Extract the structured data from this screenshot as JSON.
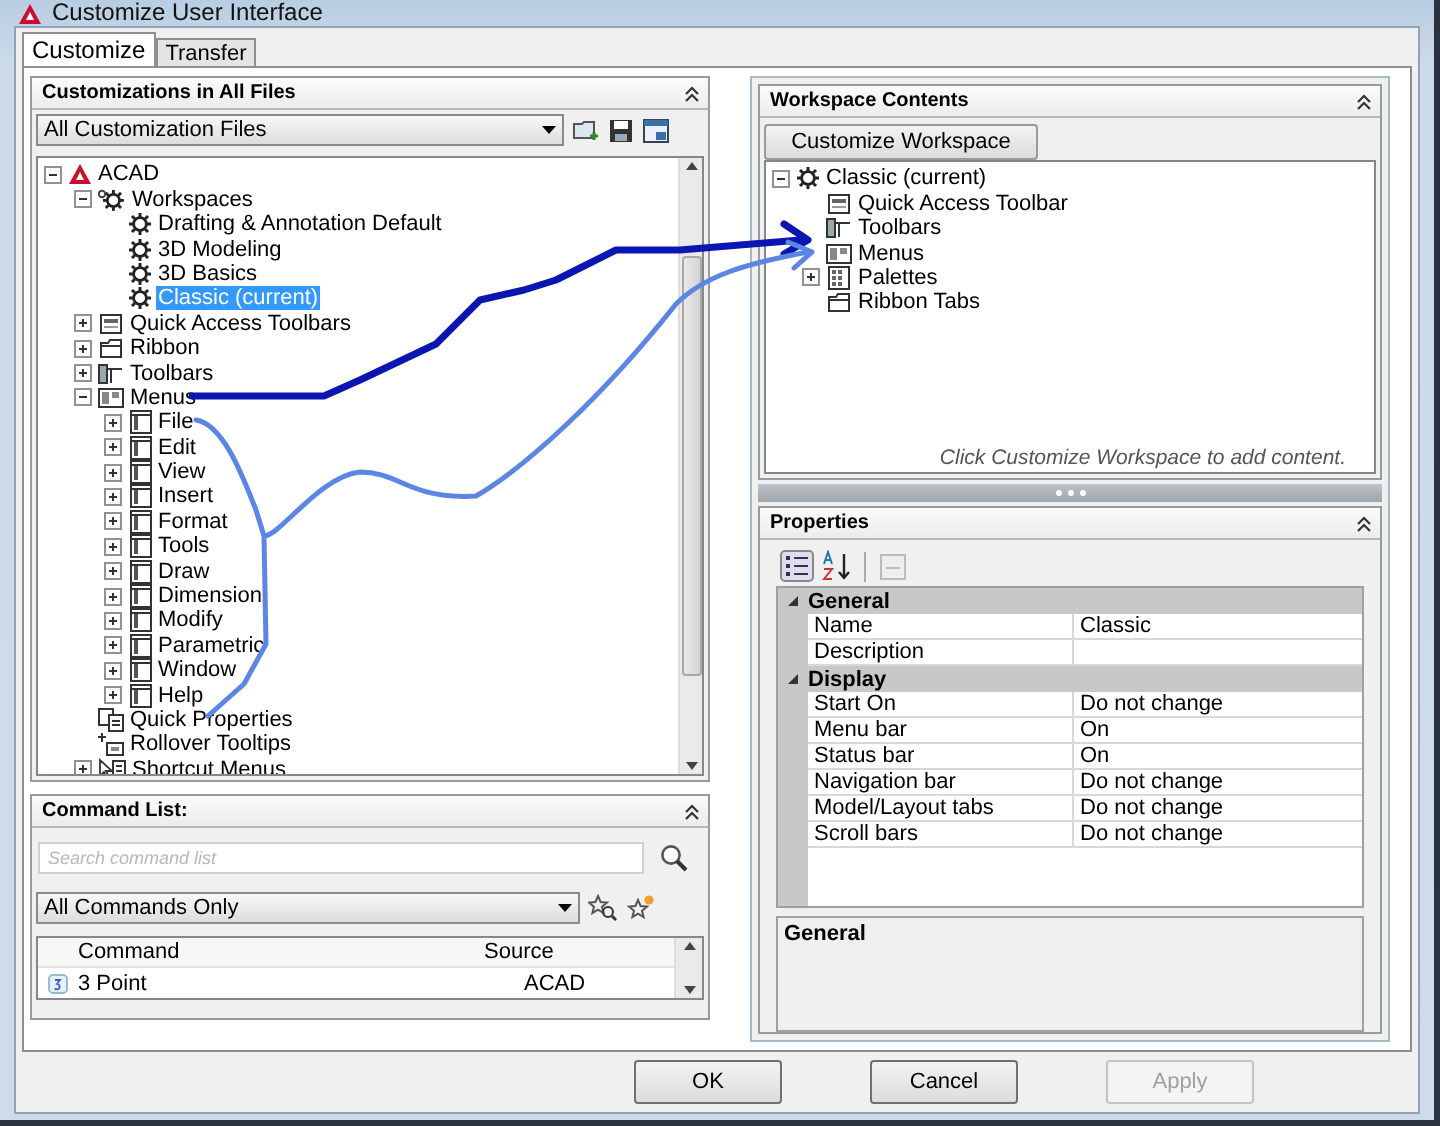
{
  "window": {
    "title": "Customize User Interface"
  },
  "tabs": [
    {
      "label": "Customize",
      "selected": true
    },
    {
      "label": "Transfer",
      "selected": false
    }
  ],
  "customizations_panel": {
    "title": "Customizations in All Files",
    "filter": "All Customization Files",
    "tree": [
      {
        "label": "ACAD",
        "kind": "logo",
        "expanded": true,
        "selected": false,
        "children": [
          {
            "label": "Workspaces",
            "kind": "gears",
            "expanded": true,
            "selected": false,
            "children": [
              {
                "label": "Drafting & Annotation Default",
                "kind": "gear",
                "selected": false
              },
              {
                "label": "3D Modeling",
                "kind": "gear",
                "selected": false
              },
              {
                "label": "3D Basics",
                "kind": "gear",
                "selected": false
              },
              {
                "label": "Classic (current)",
                "kind": "gear",
                "selected": true
              }
            ]
          },
          {
            "label": "Quick Access Toolbars",
            "kind": "qat",
            "expanded": false,
            "selected": false
          },
          {
            "label": "Ribbon",
            "kind": "ribbon",
            "expanded": false,
            "selected": false
          },
          {
            "label": "Toolbars",
            "kind": "toolbar",
            "expanded": false,
            "selected": false
          },
          {
            "label": "Menus",
            "kind": "menus",
            "expanded": true,
            "selected": false,
            "children": [
              {
                "label": "File",
                "kind": "menu",
                "expanded": false,
                "selected": false
              },
              {
                "label": "Edit",
                "kind": "menu",
                "expanded": false,
                "selected": false
              },
              {
                "label": "View",
                "kind": "menu",
                "expanded": false,
                "selected": false
              },
              {
                "label": "Insert",
                "kind": "menu",
                "expanded": false,
                "selected": false
              },
              {
                "label": "Format",
                "kind": "menu",
                "expanded": false,
                "selected": false
              },
              {
                "label": "Tools",
                "kind": "menu",
                "expanded": false,
                "selected": false
              },
              {
                "label": "Draw",
                "kind": "menu",
                "expanded": false,
                "selected": false
              },
              {
                "label": "Dimension",
                "kind": "menu",
                "expanded": false,
                "selected": false
              },
              {
                "label": "Modify",
                "kind": "menu",
                "expanded": false,
                "selected": false
              },
              {
                "label": "Parametric",
                "kind": "menu",
                "expanded": false,
                "selected": false
              },
              {
                "label": "Window",
                "kind": "menu",
                "expanded": false,
                "selected": false
              },
              {
                "label": "Help",
                "kind": "menu",
                "expanded": false,
                "selected": false
              }
            ]
          },
          {
            "label": "Quick Properties",
            "kind": "props",
            "selected": false
          },
          {
            "label": "Rollover Tooltips",
            "kind": "tooltip",
            "selected": false
          },
          {
            "label": "Shortcut Menus",
            "kind": "shortcut",
            "expanded": false,
            "selected": false
          }
        ]
      }
    ]
  },
  "command_list": {
    "title": "Command List:",
    "search": {
      "placeholder": "Search command list"
    },
    "filter": "All Commands Only",
    "columns": [
      "Command",
      "Source"
    ],
    "rows": [
      {
        "command": "3 Point",
        "source": "ACAD"
      }
    ]
  },
  "workspace_contents": {
    "title": "Workspace Contents",
    "button": "Customize Workspace",
    "tree": [
      {
        "label": "Classic (current)",
        "kind": "gear",
        "expanded": true,
        "children": [
          {
            "label": "Quick Access Toolbar",
            "kind": "qat"
          },
          {
            "label": "Toolbars",
            "kind": "toolbar"
          },
          {
            "label": "Menus",
            "kind": "menus"
          },
          {
            "label": "Palettes",
            "kind": "palette",
            "expanded": false
          },
          {
            "label": "Ribbon Tabs",
            "kind": "ribbon"
          }
        ]
      }
    ],
    "hint": "Click Customize Workspace to add content."
  },
  "properties": {
    "title": "Properties",
    "categories": [
      {
        "name": "General",
        "expanded": true,
        "rows": [
          {
            "name": "Name",
            "value": "Classic"
          },
          {
            "name": "Description"
          }
        ]
      },
      {
        "name": "Display",
        "expanded": true,
        "rows": [
          {
            "name": "Start On",
            "value": "Do not change"
          },
          {
            "name": "Menu bar",
            "value": "On"
          },
          {
            "name": "Status bar",
            "value": "On"
          },
          {
            "name": "Navigation bar",
            "value": "Do not change"
          },
          {
            "name": "Model/Layout tabs",
            "value": "Do not change"
          },
          {
            "name": "Scroll bars",
            "value": "Do not change"
          }
        ]
      }
    ],
    "description_title": "General"
  },
  "buttons": [
    {
      "label": "OK",
      "disabled": false
    },
    {
      "label": "Cancel",
      "disabled": false
    },
    {
      "label": "Apply",
      "disabled": true
    }
  ]
}
